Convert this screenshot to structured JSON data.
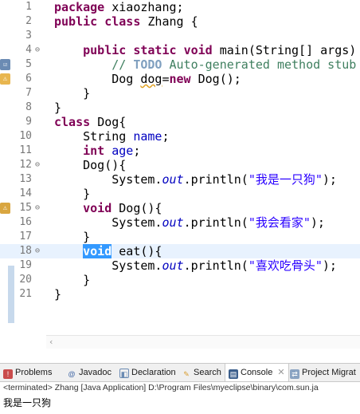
{
  "editor": {
    "lines": [
      {
        "n": "1"
      },
      {
        "n": "2"
      },
      {
        "n": "3"
      },
      {
        "n": "4"
      },
      {
        "n": "5"
      },
      {
        "n": "6"
      },
      {
        "n": "7"
      },
      {
        "n": "8"
      },
      {
        "n": "9"
      },
      {
        "n": "10"
      },
      {
        "n": "11"
      },
      {
        "n": "12"
      },
      {
        "n": "13"
      },
      {
        "n": "14"
      },
      {
        "n": "15"
      },
      {
        "n": "16"
      },
      {
        "n": "17"
      },
      {
        "n": "18"
      },
      {
        "n": "19"
      },
      {
        "n": "20"
      },
      {
        "n": "21"
      }
    ],
    "tokens": {
      "package": "package",
      "pkg_name": "xiaozhang;",
      "public": "public",
      "class": "class",
      "zhang": "Zhang {",
      "static": "static",
      "void": "void",
      "main_sig": "main(String[] args) {",
      "comment_prefix": "// ",
      "todo": "TODO",
      "comment_rest": " Auto-generated method stub",
      "dog_type": "Dog ",
      "dog_var": "dog",
      "eq": "=",
      "new": "new",
      "dog_ctor": " Dog();",
      "close_brace": "}",
      "class_dog": "Dog{",
      "string_type": "String ",
      "name_field": "name",
      "semicolon": ";",
      "int": "int",
      "age_field": "age",
      "dog_ctor_decl": "Dog(){",
      "sys": "System.",
      "out": "out",
      "println_open": ".println(",
      "str1": "\"我是一只狗\"",
      "str2": "\"我会看家\"",
      "str3": "\"喜欢吃骨头\"",
      "close_call": ");",
      "dog_method": " Dog(){",
      "eat_method": " eat(){"
    },
    "scroll_left_arrow": "‹"
  },
  "bottom_panel": {
    "tabs": [
      {
        "label": "Problems",
        "icon": "problems-icon"
      },
      {
        "label": "Javadoc",
        "icon": "javadoc-icon"
      },
      {
        "label": "Declaration",
        "icon": "declaration-icon"
      },
      {
        "label": "Search",
        "icon": "search-icon"
      },
      {
        "label": "Console",
        "icon": "console-icon",
        "active": true
      },
      {
        "label": "Project Migrat",
        "icon": "project-migration-icon"
      }
    ],
    "close_glyph": "✕",
    "status": "<terminated> Zhang [Java Application] D:\\Program Files\\myeclipse\\binary\\com.sun.ja",
    "output": "我是一只狗"
  },
  "colors": {
    "keyword": "#7f0055",
    "comment": "#3f7f5f",
    "field": "#0000c0",
    "string": "#2a00ff",
    "selection": "#3399ff",
    "current_line": "#e8f2fe"
  }
}
